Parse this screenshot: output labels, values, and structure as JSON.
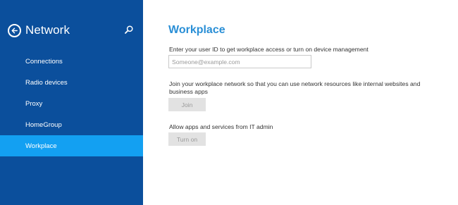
{
  "sidebar": {
    "title": "Network",
    "back_icon": "back-arrow-icon",
    "search_icon": "search-icon",
    "items": [
      {
        "label": "Connections",
        "selected": false
      },
      {
        "label": "Radio devices",
        "selected": false
      },
      {
        "label": "Proxy",
        "selected": false
      },
      {
        "label": "HomeGroup",
        "selected": false
      },
      {
        "label": "Workplace",
        "selected": true
      }
    ]
  },
  "main": {
    "title": "Workplace",
    "user_id_label": "Enter your user ID to get workplace access or turn on device management",
    "user_id_input": {
      "value": "",
      "placeholder": "Someone@example.com"
    },
    "join_label": "Join your workplace network so that you can use network resources like internal websites and business apps",
    "join_button": "Join",
    "allow_label": "Allow apps and services from IT admin",
    "turn_on_button": "Turn on"
  },
  "colors": {
    "sidebar_bg": "#0b4f9c",
    "selected_bg": "#13a0f2",
    "title_accent": "#2a8fd6",
    "button_bg": "#e2e2e2"
  }
}
